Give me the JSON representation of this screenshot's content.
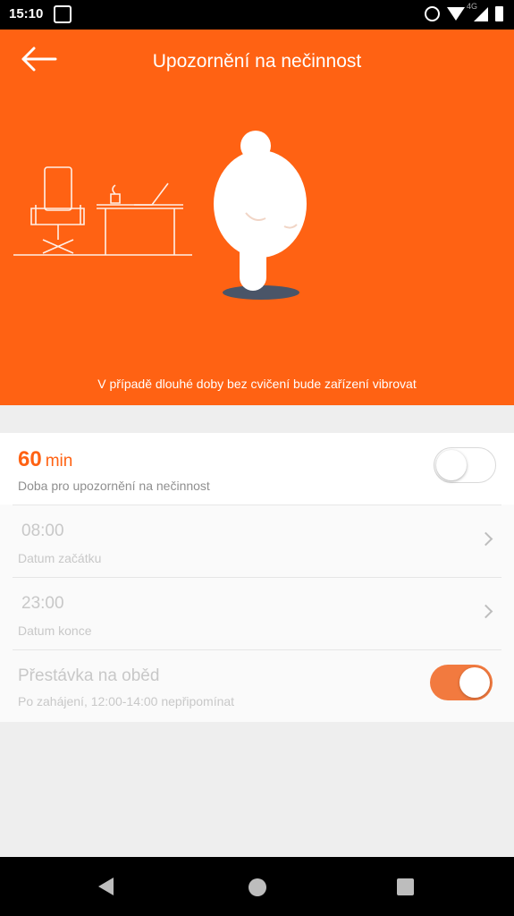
{
  "status_bar": {
    "time": "15:10",
    "network_label": "4G",
    "icons": [
      "app-notification-icon",
      "alarm-icon",
      "wifi-icon",
      "signal-icon",
      "battery-icon"
    ]
  },
  "header": {
    "title": "Upozornění na nečinnost",
    "back_icon": "back-arrow-icon",
    "caption": "V případě dlouhé doby bez cvičení bude zařízení vibrovat",
    "illustration": "office-chair-desk-and-walking-figure"
  },
  "settings": {
    "inactivity": {
      "value": "60",
      "unit": "min",
      "label": "Doba pro upozornění na nečinnost",
      "enabled": false
    },
    "start": {
      "value": "08:00",
      "label": "Datum začátku"
    },
    "end": {
      "value": "23:00",
      "label": "Datum konce"
    },
    "lunch_break": {
      "title": "Přestávka na oběd",
      "label": "Po zahájení, 12:00-14:00 nepřipomínat",
      "enabled": true
    }
  },
  "nav_bar": {
    "icons": [
      "nav-back-icon",
      "nav-home-icon",
      "nav-recents-icon"
    ]
  },
  "colors": {
    "accent": "#ff6213",
    "toggle_on": "#f27a3f",
    "status_bar": "#000000",
    "background": "#eeeeee"
  }
}
